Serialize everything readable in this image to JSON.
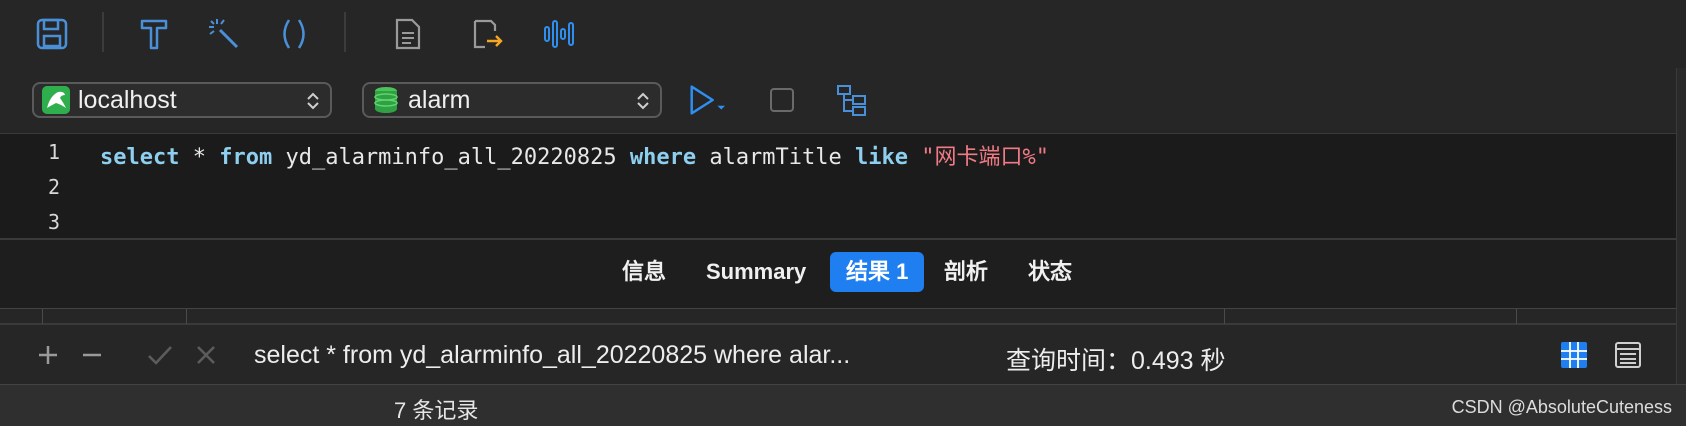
{
  "toolbar": {
    "icons": [
      "save-icon",
      "hammer-icon",
      "magic-wand-icon",
      "parentheses-icon",
      "document-icon",
      "export-icon",
      "waveform-icon"
    ]
  },
  "connection": {
    "host": "localhost",
    "database": "alarm"
  },
  "editor": {
    "line_numbers": [
      "1",
      "2",
      "3"
    ],
    "kw_select": "select",
    "star": " * ",
    "kw_from": "from",
    "table": " yd_alarminfo_all_20220825 ",
    "kw_where": "where",
    "column": " alarmTitle ",
    "kw_like": "like",
    "literal": " \"网卡端口%\""
  },
  "tabs": {
    "info": "信息",
    "summary": "Summary",
    "result": "结果 1",
    "profile": "剖析",
    "status": "状态"
  },
  "statusbar": {
    "query_preview": "select * from yd_alarminfo_all_20220825 where alar...",
    "query_time": "查询时间：0.493 秒"
  },
  "footer": {
    "records": "7 条记录",
    "watermark": "CSDN @AbsoluteCuteness"
  },
  "colors": {
    "accent": "#1f7ff0",
    "keyword": "#8ecfef",
    "string": "#f07b86"
  }
}
